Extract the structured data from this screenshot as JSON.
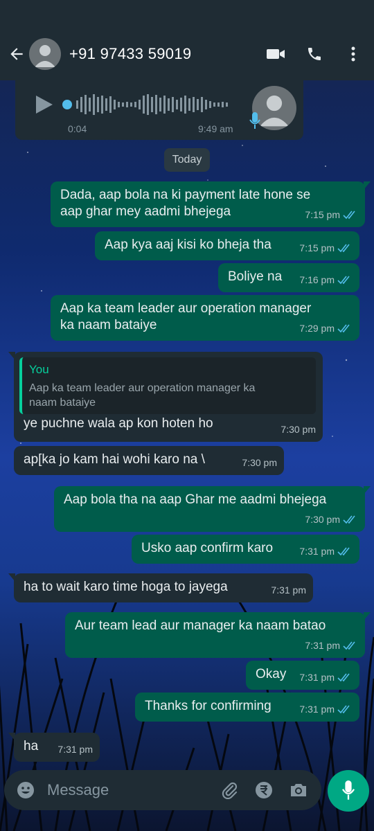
{
  "header": {
    "contact_name": "+91 97433 59019",
    "icons": [
      "back-arrow-icon",
      "avatar",
      "video-call-icon",
      "voice-call-icon",
      "more-options-icon"
    ]
  },
  "voice_note": {
    "duration": "0:04",
    "time": "9:49 am"
  },
  "date_divider": "Today",
  "messages": [
    {
      "dir": "out",
      "text_lines": [
        "Dada, aap bola na ki payment late hone se",
        "aap ghar mey aadmi bhejega"
      ],
      "time": "7:15 pm"
    },
    {
      "dir": "out",
      "text": "Aap kya aaj kisi ko bheja tha",
      "time": "7:15 pm"
    },
    {
      "dir": "out",
      "text": "Boliye na",
      "time": "7:16 pm"
    },
    {
      "dir": "out",
      "text_lines": [
        "Aap ka team leader aur operation manager",
        "ka naam bataiye"
      ],
      "time": "7:29 pm"
    },
    {
      "dir": "in",
      "reply_to_name": "You",
      "reply_to_lines": [
        "Aap ka team leader aur operation manager ka",
        "naam bataiye"
      ],
      "text": "ye puchne wala ap kon hoten  ho",
      "time": "7:30 pm"
    },
    {
      "dir": "in",
      "text": "ap[ka jo kam hai wohi karo na \\",
      "time": "7:30 pm"
    },
    {
      "dir": "out",
      "text": "Aap bola tha na aap Ghar me aadmi bhejega",
      "time": "7:30 pm"
    },
    {
      "dir": "out",
      "text": "Usko aap confirm karo",
      "time": "7:31 pm"
    },
    {
      "dir": "in",
      "text": "ha to wait karo  time hoga to jayega",
      "time": "7:31 pm"
    },
    {
      "dir": "out",
      "text": "Aur team lead aur manager ka naam batao",
      "time": "7:31 pm"
    },
    {
      "dir": "out",
      "text": "Okay",
      "time": "7:31 pm"
    },
    {
      "dir": "out",
      "text": "Thanks for confirming",
      "time": "7:31 pm"
    },
    {
      "dir": "in",
      "text": "ha",
      "time": "7:31 pm"
    }
  ],
  "input": {
    "placeholder": "Message"
  },
  "colors": {
    "outgoing": "#005c4b",
    "incoming": "#1f2c34",
    "accent": "#00a884",
    "read_ticks": "#53bdeb"
  }
}
